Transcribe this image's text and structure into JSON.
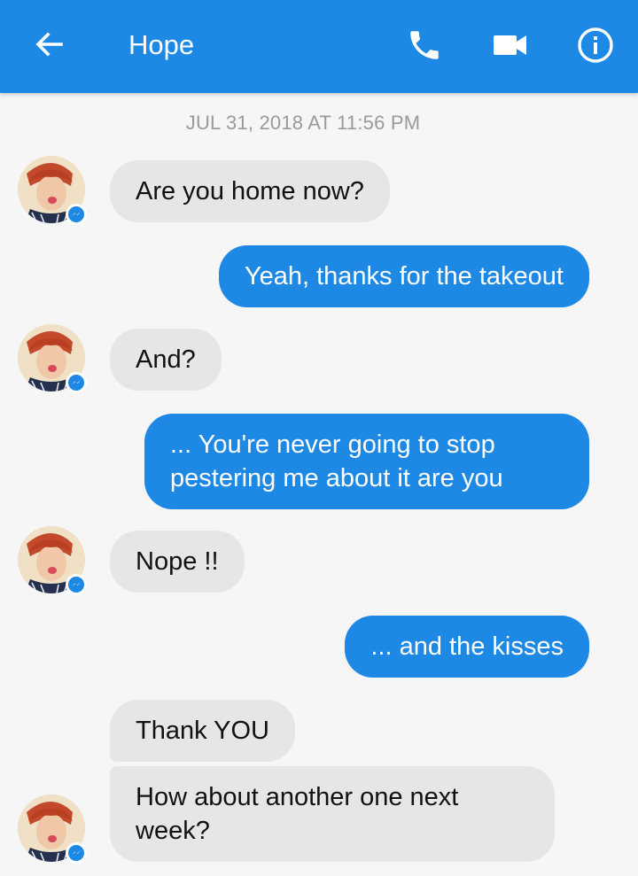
{
  "header": {
    "title": "Hope",
    "accent_color": "#1e88e5",
    "icons": [
      "back-arrow-icon",
      "phone-icon",
      "video-camera-icon",
      "info-icon"
    ]
  },
  "conversation": {
    "timestamp": "JUL 31, 2018 AT 11:56 PM",
    "messages": [
      {
        "from": "Hope",
        "text": "Are you home now?"
      },
      {
        "from": "me",
        "text": "Yeah, thanks for the takeout"
      },
      {
        "from": "Hope",
        "text": "And?"
      },
      {
        "from": "me",
        "text": "... You're never going to stop pestering me about it are you"
      },
      {
        "from": "Hope",
        "text": "Nope !!"
      },
      {
        "from": "me",
        "text": "... and the kisses"
      },
      {
        "from": "Hope",
        "text": "Thank YOU"
      },
      {
        "from": "Hope",
        "text": "How about another one next week?"
      }
    ]
  },
  "colors": {
    "incoming_bubble": "#e6e6e6",
    "outgoing_bubble": "#1e88e5",
    "background": "#f6f6f6"
  }
}
